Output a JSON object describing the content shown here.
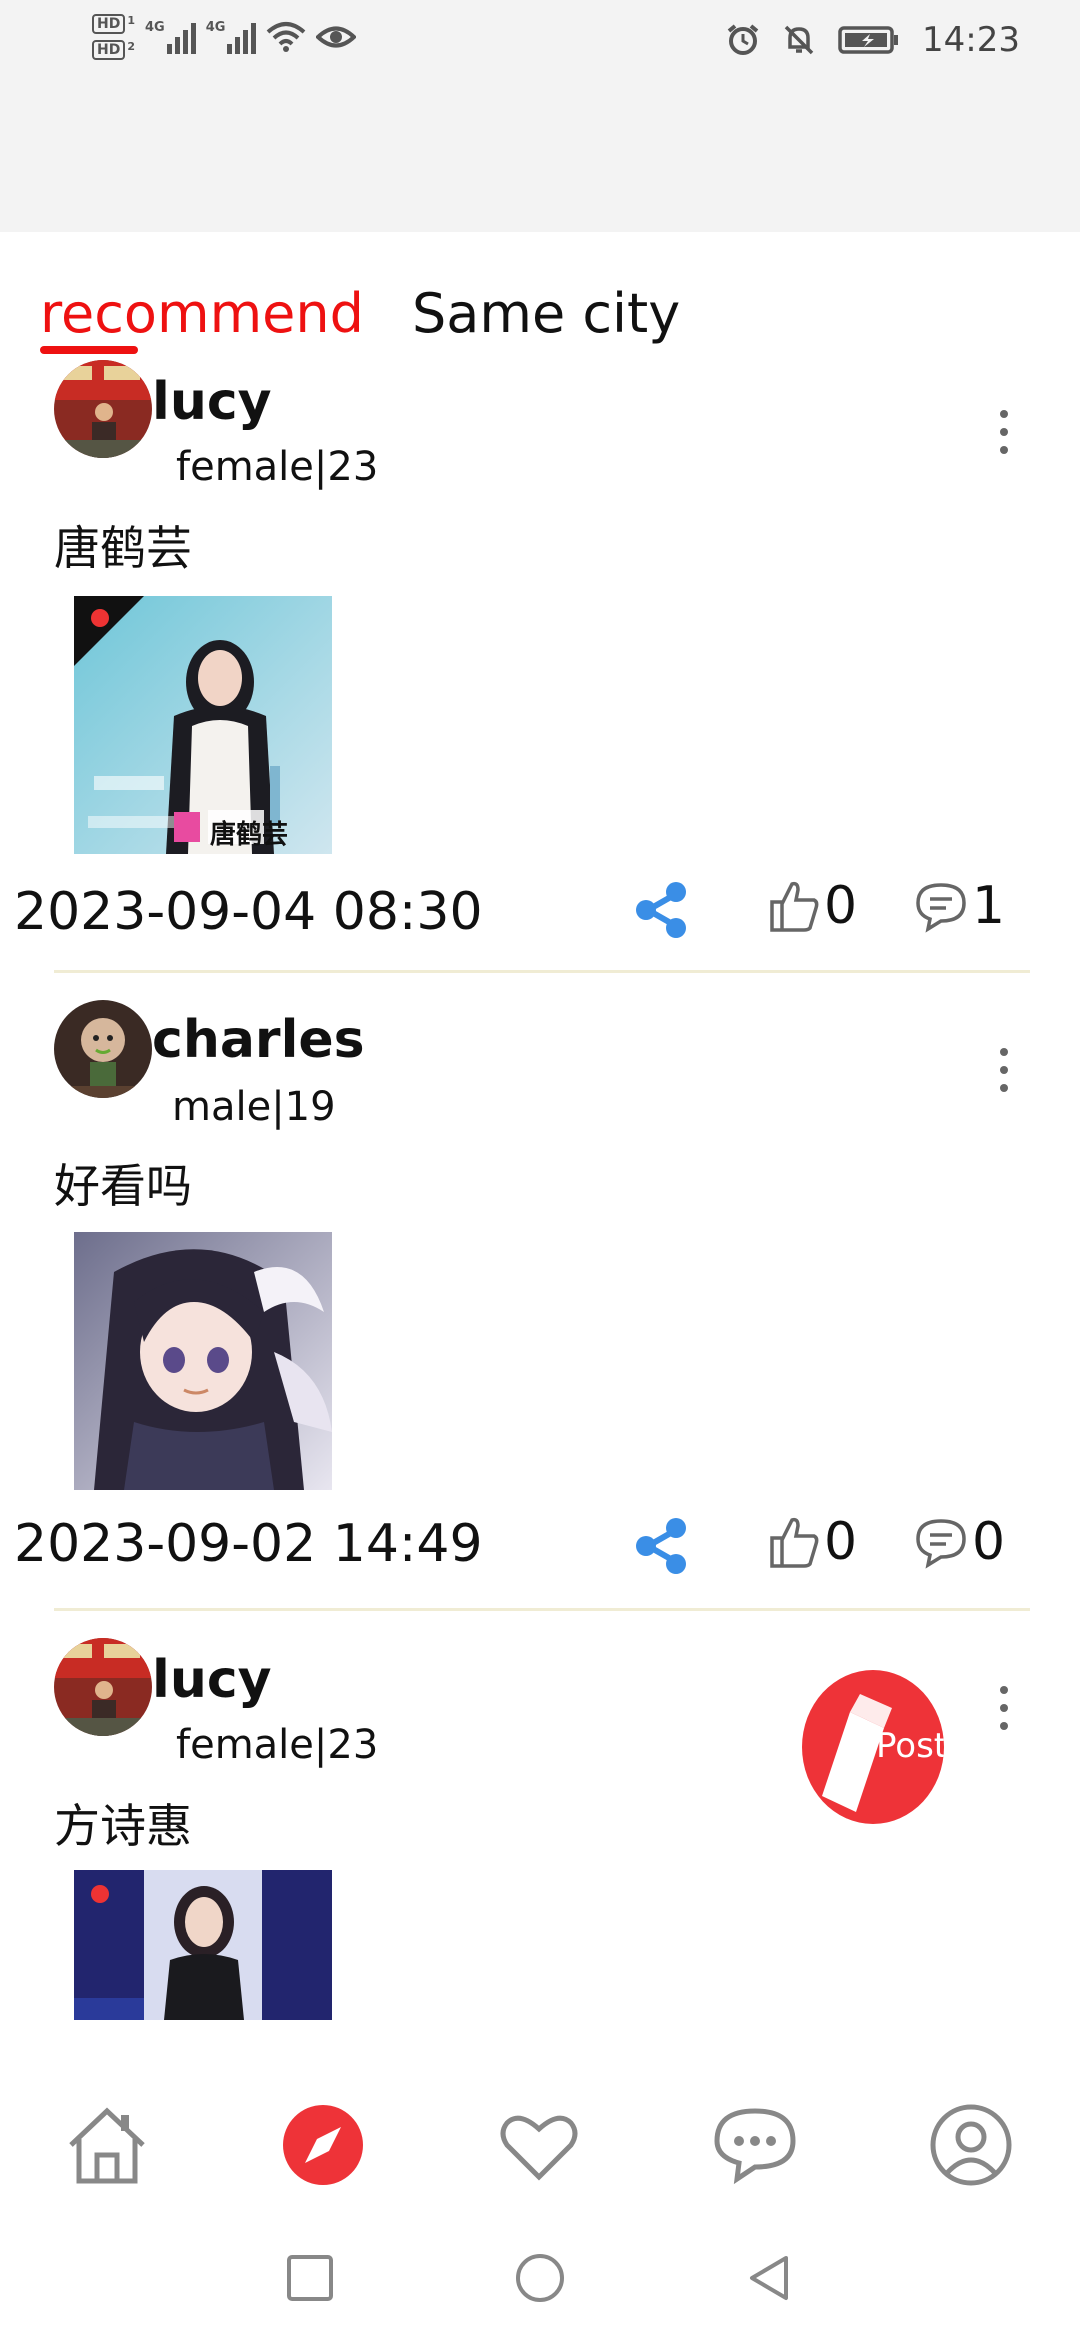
{
  "status_bar": {
    "sim1": "HD",
    "sim1_index": "1",
    "sim2": "HD",
    "sim2_index": "2",
    "network1": "4G",
    "network2": "4G",
    "time": "14:23"
  },
  "tabs": [
    {
      "label": "recommend",
      "active": true
    },
    {
      "label": "Same city",
      "active": false
    }
  ],
  "posts": [
    {
      "username": "lucy",
      "gender_age": "female|23",
      "text": "唐鹤芸",
      "image_caption": "唐鹤芸",
      "timestamp": "2023-09-04 08:30",
      "likes": "0",
      "comments": "1"
    },
    {
      "username": "charles",
      "gender_age": "male|19",
      "text": "好看吗",
      "timestamp": "2023-09-02 14:49",
      "likes": "0",
      "comments": "0"
    },
    {
      "username": "lucy",
      "gender_age": "female|23",
      "text": "方诗惠"
    }
  ],
  "post_button": {
    "label": "Post"
  },
  "bottom_nav": [
    {
      "icon": "home-icon"
    },
    {
      "icon": "compass-icon",
      "active": true
    },
    {
      "icon": "heart-icon"
    },
    {
      "icon": "chat-icon"
    },
    {
      "icon": "profile-icon"
    }
  ],
  "colors": {
    "accent": "#ee1111",
    "share": "#3a8ee6"
  }
}
